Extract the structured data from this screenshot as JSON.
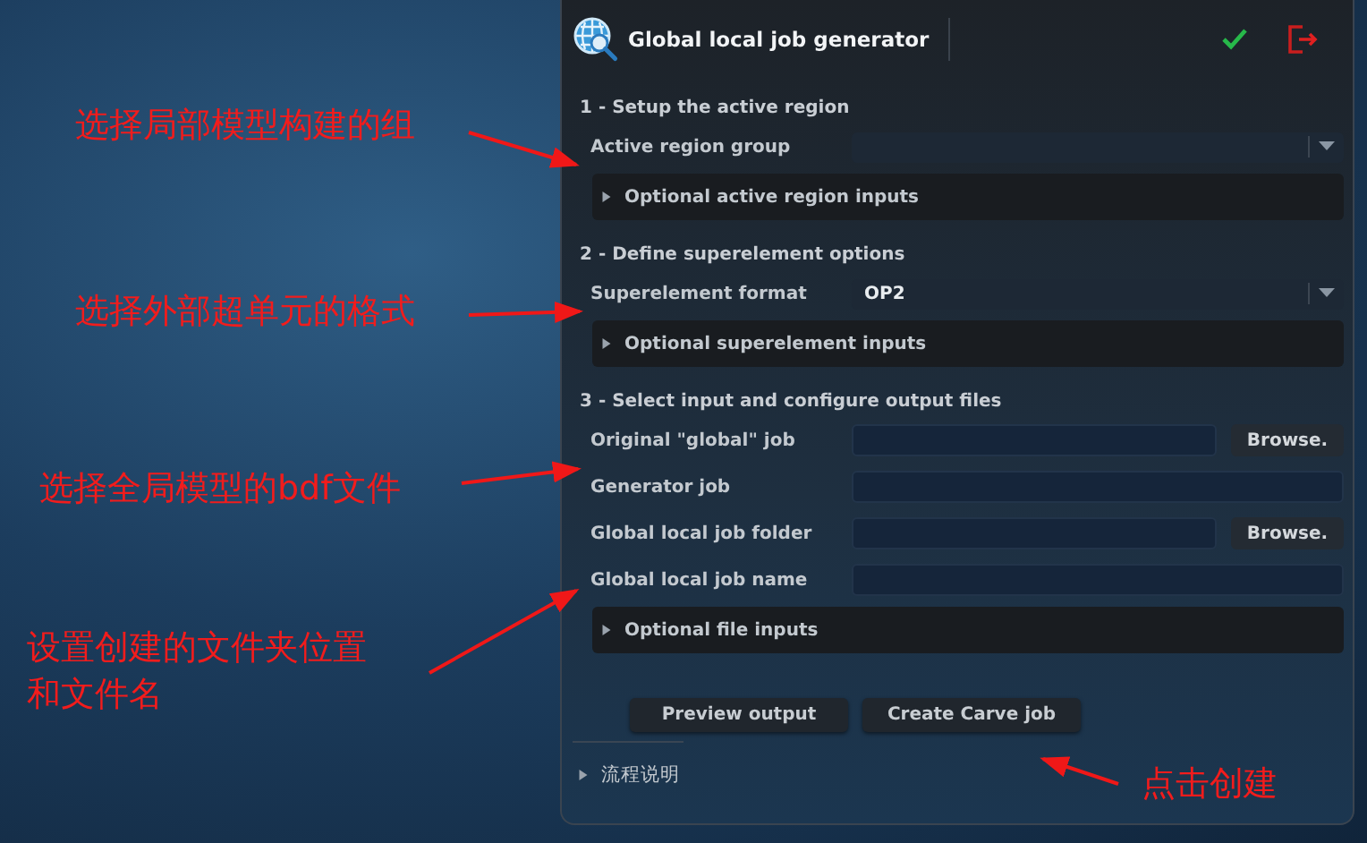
{
  "panel": {
    "title": "Global local job generator",
    "sections": [
      {
        "heading": "1 - Setup the active region",
        "rows": [
          {
            "kind": "dropdown",
            "label": "Active region group",
            "value": ""
          }
        ],
        "optional": {
          "label": "Optional active region inputs",
          "expanded": false
        }
      },
      {
        "heading": "2 - Define superelement options",
        "rows": [
          {
            "kind": "dropdown",
            "label": "Superelement format",
            "value": "OP2"
          }
        ],
        "optional": {
          "label": "Optional superelement inputs",
          "expanded": false
        }
      },
      {
        "heading": "3 - Select input and configure output files",
        "rows": [
          {
            "kind": "browse",
            "label": "Original \"global\" job",
            "value": "",
            "button": "Browse."
          },
          {
            "kind": "text",
            "label": "Generator job",
            "value": ""
          },
          {
            "kind": "browse",
            "label": "Global local job folder",
            "value": "",
            "button": "Browse."
          },
          {
            "kind": "text",
            "label": "Global local job name",
            "value": ""
          }
        ],
        "optional": {
          "label": "Optional file inputs",
          "expanded": false
        }
      }
    ],
    "buttons": [
      "Preview output",
      "Create Carve job"
    ],
    "footer": {
      "label": "流程说明",
      "expanded": false
    }
  },
  "annotations": [
    {
      "text": "选择局部模型构建的组"
    },
    {
      "text": "选择外部超单元的格式"
    },
    {
      "text": "选择全局模型的bdf文件"
    },
    {
      "text": "设置创建的文件夹位置和文件名"
    },
    {
      "text": "点击创建"
    }
  ]
}
